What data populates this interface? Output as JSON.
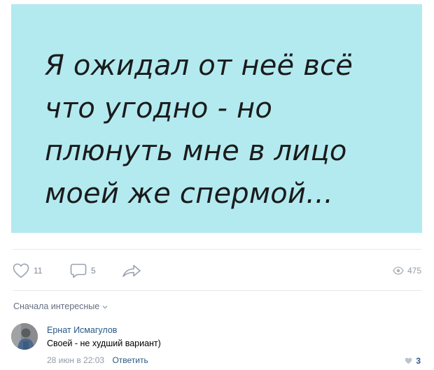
{
  "post": {
    "image_text_lines": [
      "Я ожидал от неё всё",
      "что угодно - но",
      "плюнуть мне в лицо",
      "моей же спермой..."
    ],
    "image_background": "#b3eaf0"
  },
  "actions": {
    "likes": "11",
    "comments": "5",
    "views": "475"
  },
  "comments_section": {
    "sort_label": "Сначала интересные",
    "items": [
      {
        "author": "Ернат Исмагулов",
        "text": "Своей - не худший вариант)",
        "date": "28 июн в 22:03",
        "reply_label": "Ответить",
        "likes": "3"
      }
    ]
  },
  "colors": {
    "link": "#2a5885",
    "muted": "#828a99",
    "divider": "#e7e8ec"
  }
}
